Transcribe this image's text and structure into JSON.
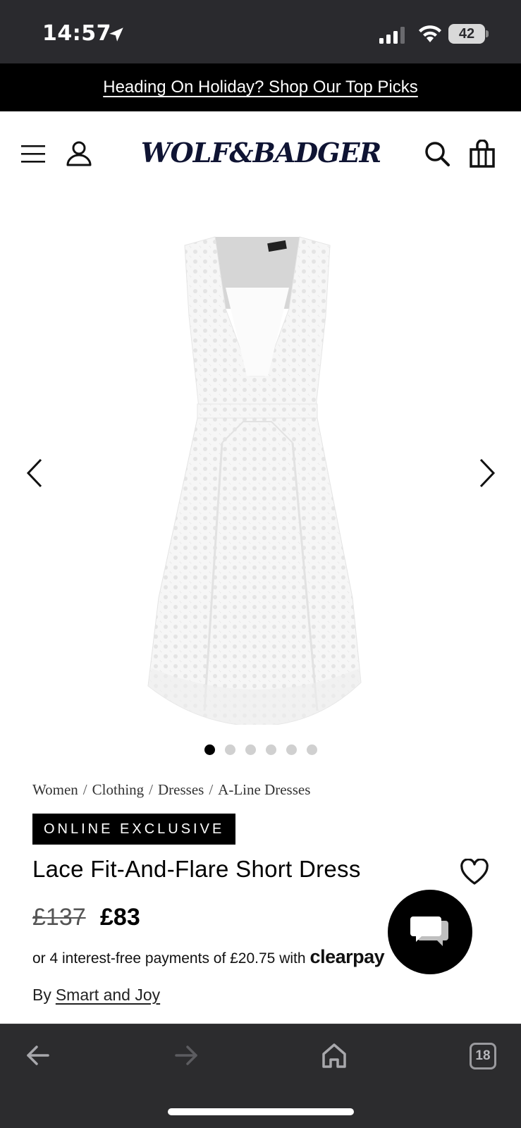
{
  "status_bar": {
    "time": "14:57",
    "battery": "42"
  },
  "promo": {
    "text": "Heading On Holiday? Shop Our Top Picks"
  },
  "header": {
    "logo": "WOLF&BADGER"
  },
  "gallery": {
    "dot_count": 6,
    "active_index": 0
  },
  "breadcrumb": [
    "Women",
    "Clothing",
    "Dresses",
    "A-Line Dresses"
  ],
  "product": {
    "badge": "ONLINE EXCLUSIVE",
    "title": "Lace Fit-And-Flare Short Dress",
    "price_old": "£137",
    "price_new": "£83",
    "installments_text": "or 4 interest-free payments of £20.75 with",
    "installments_provider": "clearpay",
    "brand_prefix": "By",
    "brand_name": "Smart and Joy"
  },
  "browser": {
    "tab_count": "18"
  }
}
